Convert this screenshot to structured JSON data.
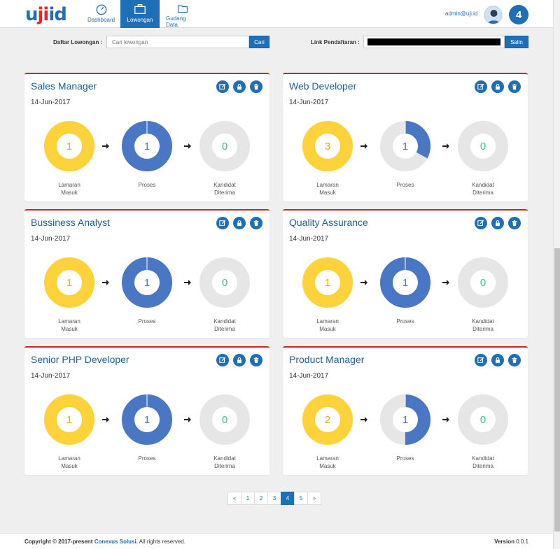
{
  "app": {
    "logo": {
      "part1": "u",
      "part2": "ji",
      "part3": "id"
    },
    "nav": [
      {
        "label": "Dashboard",
        "icon": "dashboard-icon"
      },
      {
        "label": "Lowongan",
        "icon": "briefcase-icon",
        "active": true
      },
      {
        "label": "Gudang Data",
        "icon": "folder-icon"
      }
    ],
    "user_email": "admin@uji.id",
    "notification_count": "4"
  },
  "filters": {
    "daftar_label": "Daftar Lowongan :",
    "search_placeholder": "Cari lowongan",
    "search_button": "Cari",
    "link_label": "Link Pendaftaran :",
    "copy_button": "Salin"
  },
  "labels": {
    "masuk_line1": "Lamaran",
    "masuk_line2": "Masuk",
    "proses": "Proses",
    "diterima_line1": "Kandidat",
    "diterima_line2": "Diterima"
  },
  "colors": {
    "primary": "#1e6fb5",
    "title": "#1d5f93",
    "accent_red": "#cc2229",
    "donut_yellow": "#fdd23b",
    "donut_blue": "#4a77c4",
    "donut_gray": "#e6e6e6"
  },
  "jobs": [
    {
      "title": "Sales Manager",
      "date": "14-Jun-2017",
      "masuk": "1",
      "proses": "1",
      "diterima": "0",
      "proses_fill": 1.0
    },
    {
      "title": "Web Developer",
      "date": "14-Jun-2017",
      "masuk": "3",
      "proses": "1",
      "diterima": "0",
      "proses_fill": 0.33
    },
    {
      "title": "Bussiness Analyst",
      "date": "14-Jun-2017",
      "masuk": "1",
      "proses": "1",
      "diterima": "0",
      "proses_fill": 1.0
    },
    {
      "title": "Quality Assurance",
      "date": "14-Jun-2017",
      "masuk": "1",
      "proses": "1",
      "diterima": "0",
      "proses_fill": 1.0
    },
    {
      "title": "Senior PHP Developer",
      "date": "14-Jun-2017",
      "masuk": "1",
      "proses": "1",
      "diterima": "0",
      "proses_fill": 1.0
    },
    {
      "title": "Product Manager",
      "date": "14-Jun-2017",
      "masuk": "2",
      "proses": "1",
      "diterima": "0",
      "proses_fill": 0.5
    }
  ],
  "pagination": [
    "«",
    "1",
    "2",
    "3",
    "4",
    "5",
    "»"
  ],
  "pagination_active": "4",
  "footer": {
    "copyright_prefix": "Copyright © 2017-present",
    "company": "Conexus Solusi.",
    "rights": "All rights reserved.",
    "version_label": "Version",
    "version_value": "0.0.1"
  }
}
